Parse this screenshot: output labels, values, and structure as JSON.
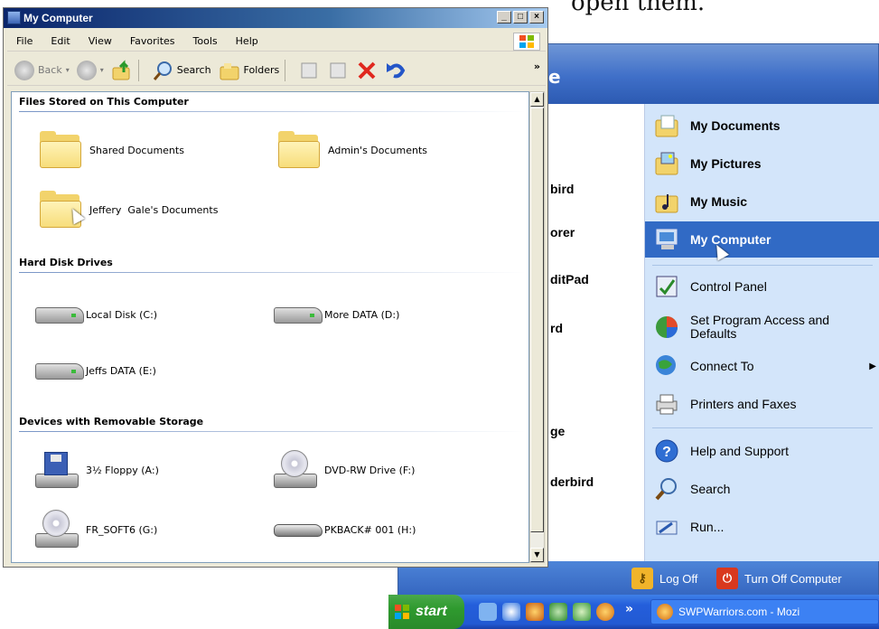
{
  "doc": {
    "text": "open them."
  },
  "window": {
    "title": "My Computer",
    "menu": [
      "File",
      "Edit",
      "View",
      "Favorites",
      "Tools",
      "Help"
    ],
    "toolbar": {
      "back": "Back",
      "search": "Search",
      "folders": "Folders"
    },
    "groups": [
      {
        "title": "Files Stored on This Computer",
        "items": [
          "Shared Documents",
          "Admin's Documents",
          "Jeffery  Gale's Documents"
        ]
      },
      {
        "title": "Hard Disk Drives",
        "items": [
          "Local Disk (C:)",
          "More DATA (D:)",
          "Jeffs DATA (E:)"
        ]
      },
      {
        "title": "Devices with Removable Storage",
        "items": [
          "3½ Floppy (A:)",
          "DVD-RW Drive (F:)",
          "FR_SOFT6 (G:)",
          "PKBACK# 001 (H:)"
        ]
      }
    ]
  },
  "start_menu": {
    "header_fragment": "e",
    "left_items": [
      "bird",
      "orer",
      "ditPad",
      "rd",
      "ge",
      "derbird"
    ],
    "right_items": [
      {
        "label": "My Documents",
        "icon": "my-documents-icon"
      },
      {
        "label": "My Pictures",
        "icon": "my-pictures-icon"
      },
      {
        "label": "My Music",
        "icon": "my-music-icon"
      },
      {
        "label": "My Computer",
        "icon": "my-computer-icon",
        "selected": true
      },
      {
        "label": "Control Panel",
        "icon": "control-panel-icon"
      },
      {
        "label": "Set Program Access and Defaults",
        "icon": "program-access-icon"
      },
      {
        "label": "Connect To",
        "icon": "connect-to-icon"
      },
      {
        "label": "Printers and Faxes",
        "icon": "printers-icon"
      },
      {
        "label": "Help and Support",
        "icon": "help-icon"
      },
      {
        "label": "Search",
        "icon": "search-icon"
      },
      {
        "label": "Run...",
        "icon": "run-icon"
      }
    ],
    "log_off": "Log Off",
    "turn_off": "Turn Off Computer"
  },
  "taskbar": {
    "start": "start",
    "task": "SWPWarriors.com - Mozi",
    "chevron": "»"
  },
  "colors": {
    "selection": "#316ac5",
    "start_menu_right": "#d3e5fa",
    "taskbar": "#245edb"
  }
}
